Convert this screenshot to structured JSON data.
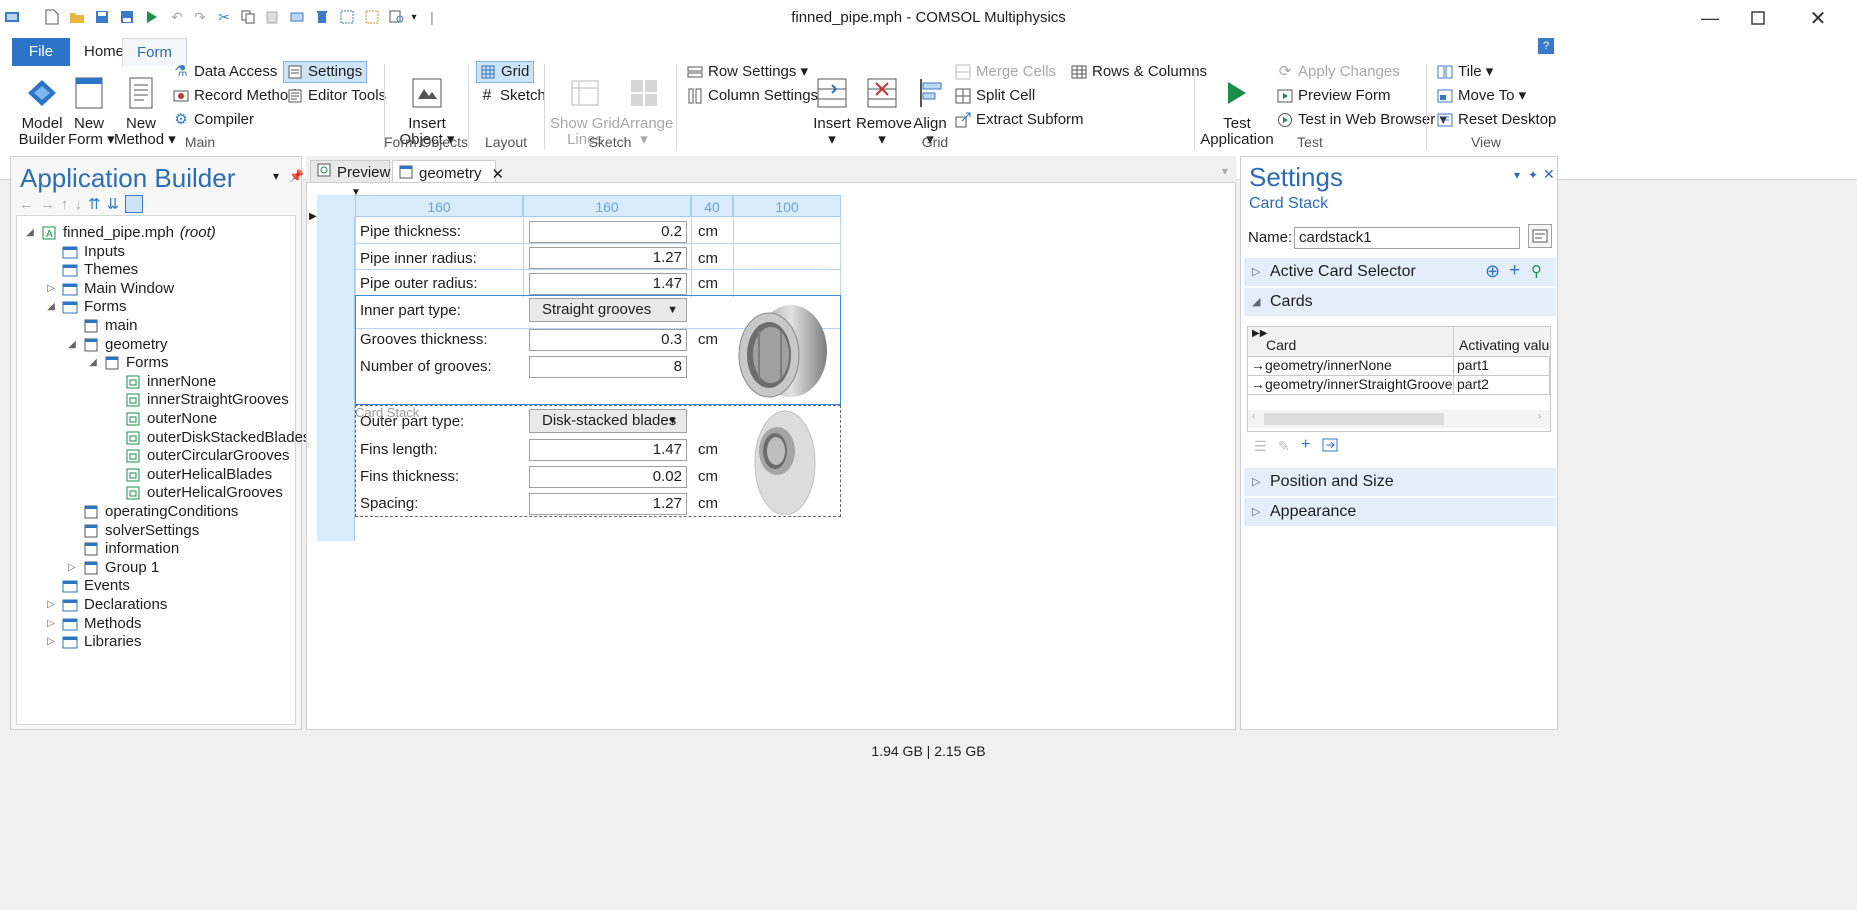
{
  "window": {
    "title": "finned_pipe.mph - COMSOL Multiphysics"
  },
  "ribbon_tabs": [
    "File",
    "Home",
    "Form"
  ],
  "ribbon": {
    "main": {
      "label": "Main",
      "model_builder": "Model\nBuilder",
      "new_form": "New\nForm ▾",
      "new_method": "New\nMethod ▾",
      "data_access": "Data Access",
      "record_method": "Record Method",
      "compiler": "Compiler",
      "settings": "Settings",
      "editor_tools": "Editor Tools"
    },
    "form_objects": {
      "label": "Form Objects",
      "insert_object": "Insert\nObject ▾"
    },
    "layout": {
      "label": "Layout",
      "grid": "Grid",
      "sketch": "Sketch"
    },
    "sketch": {
      "label": "Sketch",
      "show_grid_lines": "Show Grid\nLines",
      "arrange": "Arrange\n▾"
    },
    "grid": {
      "label": "Grid",
      "row_settings": "Row Settings ▾",
      "column_settings": "Column Settings ▾",
      "insert": "Insert\n▾",
      "remove": "Remove\n▾",
      "align": "Align\n▾",
      "merge_cells": "Merge Cells",
      "split_cell": "Split Cell",
      "extract_subform": "Extract Subform",
      "rows_columns": "Rows & Columns"
    },
    "test": {
      "label": "Test",
      "test_application": "Test\nApplication",
      "apply_changes": "Apply Changes",
      "preview_form": "Preview Form",
      "test_in_web_browser": "Test in Web Browser ▾"
    },
    "view": {
      "label": "View",
      "tile": "Tile ▾",
      "move_to": "Move To ▾",
      "reset_desktop": "Reset Desktop"
    }
  },
  "app_builder": {
    "title": "Application Builder",
    "tree": [
      {
        "label": "finned_pipe.mph",
        "suffix": "(root)",
        "depth": 0,
        "twisty": "◢"
      },
      {
        "label": "Inputs",
        "depth": 1,
        "twisty": ""
      },
      {
        "label": "Themes",
        "depth": 1,
        "twisty": ""
      },
      {
        "label": "Main Window",
        "depth": 1,
        "twisty": "▷"
      },
      {
        "label": "Forms",
        "depth": 1,
        "twisty": "◢"
      },
      {
        "label": "main",
        "depth": 2,
        "twisty": ""
      },
      {
        "label": "geometry",
        "depth": 2,
        "twisty": "◢"
      },
      {
        "label": "Forms",
        "depth": 3,
        "twisty": "◢"
      },
      {
        "label": "innerNone",
        "depth": 4,
        "twisty": ""
      },
      {
        "label": "innerStraightGrooves",
        "depth": 4,
        "twisty": ""
      },
      {
        "label": "outerNone",
        "depth": 4,
        "twisty": ""
      },
      {
        "label": "outerDiskStackedBlades",
        "depth": 4,
        "twisty": ""
      },
      {
        "label": "outerCircularGrooves",
        "depth": 4,
        "twisty": ""
      },
      {
        "label": "outerHelicalBlades",
        "depth": 4,
        "twisty": ""
      },
      {
        "label": "outerHelicalGrooves",
        "depth": 4,
        "twisty": ""
      },
      {
        "label": "operatingConditions",
        "depth": 2,
        "twisty": ""
      },
      {
        "label": "solverSettings",
        "depth": 2,
        "twisty": ""
      },
      {
        "label": "information",
        "depth": 2,
        "twisty": ""
      },
      {
        "label": "Group 1",
        "depth": 2,
        "twisty": "▷"
      },
      {
        "label": "Events",
        "depth": 1,
        "twisty": ""
      },
      {
        "label": "Declarations",
        "depth": 1,
        "twisty": "▷"
      },
      {
        "label": "Methods",
        "depth": 1,
        "twisty": "▷"
      },
      {
        "label": "Libraries",
        "depth": 1,
        "twisty": "▷"
      }
    ]
  },
  "editor_tabs": [
    {
      "label": "Preview"
    },
    {
      "label": "geometry",
      "close": "✕"
    }
  ],
  "form": {
    "col_headers": [
      "160",
      "160",
      "40",
      "100"
    ],
    "pipe_thickness_label": "Pipe thickness:",
    "pipe_thickness_value": "0.2",
    "pipe_inner_radius_label": "Pipe inner radius:",
    "pipe_inner_radius_value": "1.27",
    "pipe_outer_radius_label": "Pipe outer radius:",
    "pipe_outer_radius_value": "1.47",
    "inner_part_type_label": "Inner part type:",
    "inner_part_type_value": "Straight grooves",
    "grooves_thickness_label": "Grooves thickness:",
    "grooves_thickness_value": "0.3",
    "number_of_grooves_label": "Number of grooves:",
    "number_of_grooves_value": "8",
    "card_stack_label": "Card Stack",
    "outer_part_type_label": "Outer part type:",
    "outer_part_type_value": "Disk-stacked blades",
    "fins_length_label": "Fins length:",
    "fins_length_value": "1.47",
    "fins_thickness_label": "Fins thickness:",
    "fins_thickness_value": "0.02",
    "spacing_label": "Spacing:",
    "spacing_value": "1.27",
    "unit": "cm"
  },
  "settings": {
    "title": "Settings",
    "subtitle": "Card Stack",
    "name_label": "Name:",
    "name_value": "cardstack1",
    "sections": {
      "active_card_selector": "Active Card Selector",
      "cards": "Cards",
      "position_and_size": "Position and Size",
      "appearance": "Appearance"
    },
    "cards_table": {
      "headers": [
        "Card",
        "Activating value"
      ],
      "rows": [
        [
          "→geometry/innerNone",
          "part1"
        ],
        [
          "→geometry/innerStraightGrooves",
          "part2"
        ]
      ]
    }
  },
  "status_bar": {
    "memory": "1.94 GB | 2.15 GB"
  },
  "colors": {
    "accent": "#2a6db5",
    "file_tab": "#2b74c6",
    "form_grid": "#b9d6f2"
  }
}
